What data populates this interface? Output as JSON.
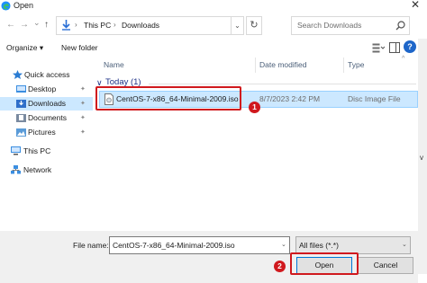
{
  "window": {
    "title": "Open",
    "close_glyph": "✕"
  },
  "address_bar": {
    "back_glyph": "←",
    "forward_glyph": "→",
    "recent_glyph": "⌄",
    "up_glyph": "↑",
    "crumbs": [
      "This PC",
      "Downloads"
    ],
    "separator": "›",
    "dropdown_glyph": "⌄",
    "refresh_glyph": "↻"
  },
  "search": {
    "placeholder": "Search Downloads"
  },
  "toolbar": {
    "organize_label": "Organize ▾",
    "new_folder_label": "New folder",
    "help_glyph": "?"
  },
  "nav": {
    "items": [
      {
        "label": "Quick access",
        "icon": "star-icon",
        "pinned": false
      },
      {
        "label": "Desktop",
        "icon": "desktop-folder-icon",
        "pinned": true
      },
      {
        "label": "Downloads",
        "icon": "downloads-folder-icon",
        "pinned": true,
        "selected": true
      },
      {
        "label": "Documents",
        "icon": "documents-folder-icon",
        "pinned": true
      },
      {
        "label": "Pictures",
        "icon": "pictures-folder-icon",
        "pinned": true
      },
      {
        "label": "This PC",
        "icon": "computer-icon",
        "pinned": false
      },
      {
        "label": "Network",
        "icon": "network-icon",
        "pinned": false
      }
    ],
    "pin_glyph": "📌"
  },
  "file_list": {
    "columns": [
      "Name",
      "Date modified",
      "Type"
    ],
    "group_label": "Today (1)",
    "group_chevron": "∨",
    "files": [
      {
        "name": "CentOS-7-x86_64-Minimal-2009.iso",
        "date": "8/7/2023 2:42 PM",
        "type": "Disc Image File",
        "selected": true
      }
    ]
  },
  "background_window_glyph": "v",
  "bottom": {
    "file_name_label": "File name:",
    "file_name_value": "CentOS-7-x86_64-Minimal-2009.iso",
    "filter_value": "All files (*.*)",
    "open_label": "Open",
    "cancel_label": "Cancel",
    "chevron_glyph": "⌄"
  },
  "annotations": {
    "step1": "1",
    "step2": "2"
  },
  "colors": {
    "accent": "#0078d7",
    "selection_bg": "#cce8ff",
    "selection_border": "#99d1ff",
    "annotation_red": "#d0191e",
    "group_header": "#1e3287",
    "folder_yellow": "#f4c542"
  }
}
